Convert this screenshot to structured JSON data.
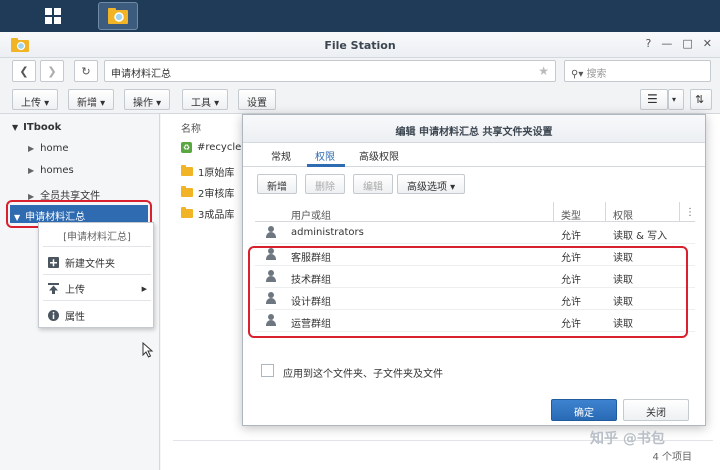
{
  "window": {
    "title": "File Station",
    "controls": [
      "?",
      "—",
      "□",
      "✕"
    ]
  },
  "nav": {
    "path": "申请材料汇总",
    "search_placeholder": "搜索"
  },
  "toolbar": {
    "upload": "上传 ▾",
    "new": "新增 ▾",
    "action": "操作 ▾",
    "tools": "工具 ▾",
    "settings": "设置"
  },
  "sidebar": {
    "root": "ITbook",
    "items": [
      {
        "label": "home"
      },
      {
        "label": "homes"
      },
      {
        "label": "全员共享文件"
      }
    ],
    "selected": "申请材料汇总"
  },
  "context_menu": {
    "header": "[申请材料汇总]",
    "items": [
      {
        "label": "新建文件夹"
      },
      {
        "label": "上传"
      },
      {
        "label": "属性"
      }
    ]
  },
  "file_list": {
    "column": "名称",
    "files": [
      {
        "name": "#recycle"
      },
      {
        "name": "1原始库"
      },
      {
        "name": "2审核库"
      },
      {
        "name": "3成品库"
      }
    ],
    "count": "4 个项目"
  },
  "dialog": {
    "title": "编辑 申请材料汇总 共享文件夹设置",
    "tabs": [
      {
        "label": "常规"
      },
      {
        "label": "权限"
      },
      {
        "label": "高级权限"
      }
    ],
    "buttons": {
      "add": "新增",
      "delete": "删除",
      "edit": "编辑",
      "advanced": "高级选项 ▾"
    },
    "table": {
      "headers": {
        "name": "用户或组",
        "type": "类型",
        "perm": "权限"
      },
      "rows": [
        {
          "name": "administrators",
          "type": "允许",
          "perm": "读取 & 写入"
        },
        {
          "name": "客服群组",
          "type": "允许",
          "perm": "读取"
        },
        {
          "name": "技术群组",
          "type": "允许",
          "perm": "读取"
        },
        {
          "name": "设计群组",
          "type": "允许",
          "perm": "读取"
        },
        {
          "name": "运营群组",
          "type": "允许",
          "perm": "读取"
        }
      ]
    },
    "apply_label": "应用到这个文件夹、子文件夹及文件",
    "ok": "确定",
    "close": "关闭"
  },
  "watermark": "知乎 @书包"
}
